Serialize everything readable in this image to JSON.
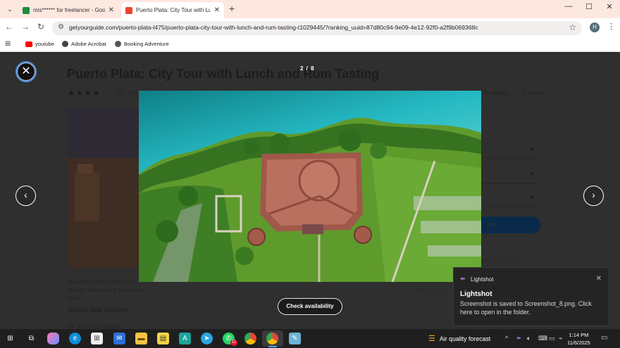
{
  "browser": {
    "tabs": [
      {
        "title": "mis****** for freelancer - Goog",
        "fav_color": "#1e8e3e"
      },
      {
        "title": "Puerto Plata: City Tour with Lun",
        "fav_color": "#e8472a"
      }
    ],
    "new_tab_symbol": "+",
    "url": "getyourguide.com/puerto-plata-l475/puerto-plata-city-tour-with-lunch-and-rum-tasting-t1029445/?ranking_uuid=87d80c94-9e09-4e12-92f0-a2f9b069368c",
    "profile_initial": "H",
    "bookmarks": [
      {
        "label": "youtube",
        "color": "#ff0000"
      },
      {
        "label": "Adobe Acrobat",
        "color": "#444444"
      },
      {
        "label": "Booking Adventure",
        "color": "#555555"
      }
    ]
  },
  "page": {
    "title": "Puerto Plata: City Tour with Lunch and Rum Tasting",
    "stars": "★★★★",
    "rating": "4.1",
    "provider_prefix": "Pro",
    "wishlist": "d to wishlist",
    "share": "Share",
    "button_partial": "ility",
    "refund_partial": "eserve for a full refund",
    "pay_later_partial": "and pay nothi",
    "description": "Discover Puerto Plata on a",
    "description2": "tasting, and savor a Dominican lunch.",
    "about_heading": "About this activity",
    "free_cancellation": "Free cancellation"
  },
  "gallery": {
    "counter": "2 / 8",
    "close_symbol": "✕",
    "prev_symbol": "‹",
    "next_symbol": "›",
    "check_availability": "Check availability",
    "photo_icon": "aerial-fortress-photo"
  },
  "toast": {
    "app": "Lightshot",
    "heading": "Lightshot",
    "body": "Screenshot is saved to Screenshot_8.png. Click here to open in the folder.",
    "close_symbol": "✕"
  },
  "taskbar": {
    "weather": "Air quality forecast",
    "time": "1:14 PM",
    "date": "11/6/2025",
    "whatsapp_badge": "11"
  }
}
